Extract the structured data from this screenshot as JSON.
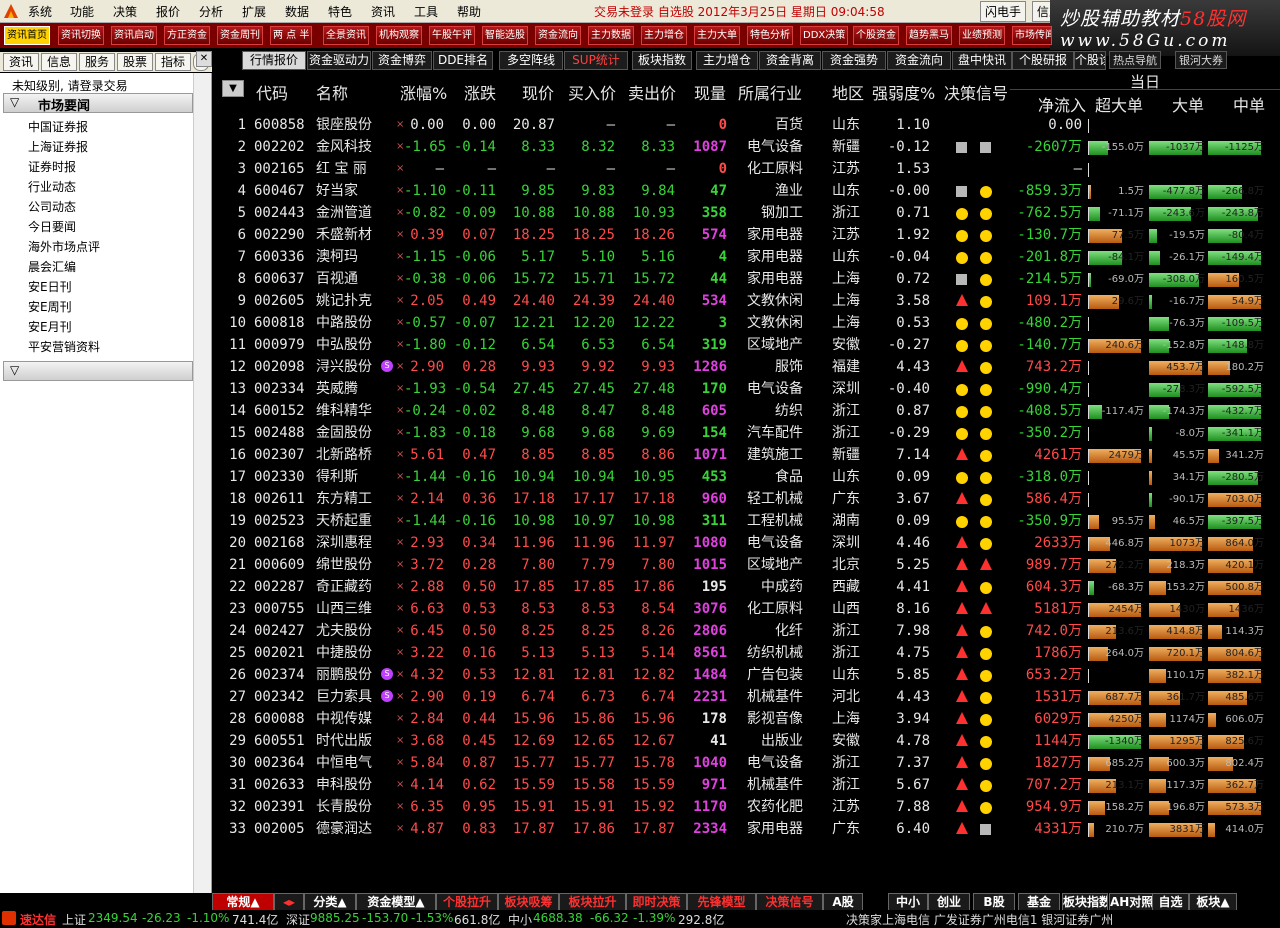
{
  "menu": {
    "items": [
      "系统",
      "功能",
      "决策",
      "报价",
      "分析",
      "扩展",
      "数据",
      "特色",
      "资讯",
      "工具",
      "帮助"
    ],
    "status": "交易未登录  自选股  2012年3月25日  星期日  09:04:58",
    "buttons": [
      "闪电手",
      "信息"
    ]
  },
  "watermark": {
    "line1a": "炒股辅助教材",
    "line1b": "58股网",
    "line2": "www.58Gu.com"
  },
  "toolbar": [
    "资讯首页",
    "资讯切换",
    "资讯启动",
    "方正资金",
    "资金周刊",
    "两 点 半",
    "全景资讯",
    "机构观察",
    "午股午评",
    "智能选股",
    "资金流向",
    "主力数据",
    "主力增仓",
    "主力大单",
    "特色分析",
    "DDX决策",
    "个股资金",
    "趋势黑马",
    "业绩预测",
    "市场传闻"
  ],
  "left": {
    "tabs": [
      "资讯",
      "信息",
      "服务",
      "股票",
      "指标"
    ],
    "login": "未知级别, 请登录交易",
    "section1": "市场要闻",
    "items": [
      "中国证券报",
      "上海证券报",
      "证券时报",
      "行业动态",
      "公司动态",
      "今日要闻",
      "海外市场点评",
      "晨会汇编",
      "安E日刊",
      "安E周刊",
      "安E月刊",
      "平安营销资料"
    ]
  },
  "toptabs": [
    "行情报价",
    "资金驱动力",
    "资金博弈",
    "DDE排名",
    "多空阵线",
    "SUP统计",
    "板块指数",
    "主力增仓",
    "资金背离",
    "资金强势",
    "资金流向",
    "盘中快讯",
    "个股研报",
    "个股诊断"
  ],
  "rtabs": [
    "热点导航",
    "银河大券"
  ],
  "header": {
    "cols": [
      "代码",
      "名称",
      "涨幅%",
      "涨跌",
      "现价",
      "买入价",
      "卖出价",
      "现量",
      "所属行业",
      "地区",
      "强弱度%",
      "决策信号",
      "净流入",
      "超大单",
      "大单",
      "中单"
    ],
    "group": "当日"
  },
  "rows": [
    {
      "n": 1,
      "code": "600858",
      "name": "银座股份",
      "pct": "0.00",
      "chg": "0.00",
      "price": "20.87",
      "bid": "—",
      "ask": "—",
      "vol": "0",
      "ind": "百货",
      "reg": "山东",
      "str": "1.10",
      "sig": [
        "",
        ""
      ],
      "net": "0.00",
      "b1": null,
      "b2": null,
      "b3": null
    },
    {
      "n": 2,
      "code": "002202",
      "name": "金风科技",
      "pct": "-1.65",
      "chg": "-0.14",
      "price": "8.33",
      "bid": "8.32",
      "ask": "8.33",
      "vol": "1087",
      "ind": "电气设备",
      "reg": "新疆",
      "str": "-0.12",
      "sig": [
        "sq",
        "sq"
      ],
      "net": "-2607万",
      "b1": {
        "v": "-155.0万",
        "w": -0.35
      },
      "b2": {
        "v": "-1037万",
        "w": -0.95
      },
      "b3": {
        "v": "-1125万",
        "w": -0.95
      }
    },
    {
      "n": 3,
      "code": "002165",
      "name": "红 宝 丽",
      "pct": "—",
      "chg": "—",
      "price": "—",
      "bid": "—",
      "ask": "—",
      "vol": "0",
      "ind": "化工原料",
      "reg": "江苏",
      "str": "1.53",
      "sig": [
        "",
        ""
      ],
      "net": "—",
      "b1": null,
      "b2": null,
      "b3": null
    },
    {
      "n": 4,
      "code": "600467",
      "name": "好当家",
      "pct": "-1.10",
      "chg": "-0.11",
      "price": "9.85",
      "bid": "9.83",
      "ask": "9.84",
      "vol": "47",
      "ind": "渔业",
      "reg": "山东",
      "str": "-0.00",
      "sig": [
        "sq",
        "ci"
      ],
      "net": "-859.3万",
      "b1": {
        "v": "1.5万",
        "w": 0.04
      },
      "b2": {
        "v": "-477.8万",
        "w": -0.95
      },
      "b3": {
        "v": "-266.8万",
        "w": -0.6
      }
    },
    {
      "n": 5,
      "code": "002443",
      "name": "金洲管道",
      "pct": "-0.82",
      "chg": "-0.09",
      "price": "10.88",
      "bid": "10.88",
      "ask": "10.93",
      "vol": "358",
      "ind": "钢加工",
      "reg": "浙江",
      "str": "0.71",
      "sig": [
        "ci",
        "ci"
      ],
      "net": "-762.5万",
      "b1": {
        "v": "-71.1万",
        "w": -0.22
      },
      "b2": {
        "v": "-243.6万",
        "w": -0.75
      },
      "b3": {
        "v": "-243.8万",
        "w": -0.9
      }
    },
    {
      "n": 6,
      "code": "002290",
      "name": "禾盛新材",
      "pct": "0.39",
      "chg": "0.07",
      "price": "18.25",
      "bid": "18.25",
      "ask": "18.26",
      "vol": "574",
      "ind": "家用电器",
      "reg": "江苏",
      "str": "1.92",
      "sig": [
        "ci",
        "ci"
      ],
      "net": "-130.7万",
      "b1": {
        "v": "77.5万",
        "w": 0.6
      },
      "b2": {
        "v": "-19.5万",
        "w": -0.15
      },
      "b3": {
        "v": "-80.4万",
        "w": -0.6
      }
    },
    {
      "n": 7,
      "code": "600336",
      "name": "澳柯玛",
      "pct": "-1.15",
      "chg": "-0.06",
      "price": "5.17",
      "bid": "5.10",
      "ask": "5.16",
      "vol": "4",
      "ind": "家用电器",
      "reg": "山东",
      "str": "-0.04",
      "sig": [
        "ci",
        "ci"
      ],
      "net": "-201.8万",
      "b1": {
        "v": "-84.1万",
        "w": -0.6
      },
      "b2": {
        "v": "-26.1万",
        "w": -0.2
      },
      "b3": {
        "v": "-149.4万",
        "w": -0.95
      }
    },
    {
      "n": 8,
      "code": "600637",
      "name": "百视通",
      "pct": "-0.38",
      "chg": "-0.06",
      "price": "15.72",
      "bid": "15.71",
      "ask": "15.72",
      "vol": "44",
      "ind": "家用电器",
      "reg": "上海",
      "str": "0.72",
      "sig": [
        "sq",
        "ci"
      ],
      "net": "-214.5万",
      "b1": {
        "v": "-69.0万",
        "w": -0.05
      },
      "b2": {
        "v": "-308.0万",
        "w": -0.9
      },
      "b3": {
        "v": "160.5万",
        "w": 0.55
      }
    },
    {
      "n": 9,
      "code": "002605",
      "name": "姚记扑克",
      "pct": "2.05",
      "chg": "0.49",
      "price": "24.40",
      "bid": "24.39",
      "ask": "24.40",
      "vol": "534",
      "ind": "文教休闲",
      "reg": "上海",
      "str": "3.58",
      "sig": [
        "tr",
        "ci"
      ],
      "net": "109.1万",
      "b1": {
        "v": "29.6万",
        "w": 0.55
      },
      "b2": {
        "v": "-16.7万",
        "w": -0.05
      },
      "b3": {
        "v": "54.9万",
        "w": 0.95
      }
    },
    {
      "n": 10,
      "code": "600818",
      "name": "中路股份",
      "pct": "-0.57",
      "chg": "-0.07",
      "price": "12.21",
      "bid": "12.20",
      "ask": "12.22",
      "vol": "3",
      "ind": "文教休闲",
      "reg": "上海",
      "str": "0.53",
      "sig": [
        "ci",
        "ci"
      ],
      "net": "-480.2万",
      "b1": null,
      "b2": {
        "v": "-76.3万",
        "w": -0.35
      },
      "b3": {
        "v": "-109.5万",
        "w": -0.95
      }
    },
    {
      "n": 11,
      "code": "000979",
      "name": "中弘股份",
      "pct": "-1.80",
      "chg": "-0.12",
      "price": "6.54",
      "bid": "6.53",
      "ask": "6.54",
      "vol": "319",
      "ind": "区域地产",
      "reg": "安徽",
      "str": "-0.27",
      "sig": [
        "ci",
        "ci"
      ],
      "net": "-140.7万",
      "b1": {
        "v": "240.6万",
        "w": 0.95
      },
      "b2": {
        "v": "-152.8万",
        "w": -0.35
      },
      "b3": {
        "v": "-148.8万",
        "w": -0.7
      }
    },
    {
      "n": 12,
      "code": "002098",
      "name": "浔兴股份",
      "badge": true,
      "pct": "2.90",
      "chg": "0.28",
      "price": "9.93",
      "bid": "9.92",
      "ask": "9.93",
      "vol": "1286",
      "ind": "服饰",
      "reg": "福建",
      "str": "4.43",
      "sig": [
        "tr",
        "ci"
      ],
      "net": "743.2万",
      "b1": null,
      "b2": {
        "v": "453.7万",
        "w": 0.95
      },
      "b3": {
        "v": "180.2万",
        "w": 0.4
      }
    },
    {
      "n": 13,
      "code": "002334",
      "name": "英威腾",
      "pct": "-1.93",
      "chg": "-0.54",
      "price": "27.45",
      "bid": "27.45",
      "ask": "27.48",
      "vol": "170",
      "ind": "电气设备",
      "reg": "深圳",
      "str": "-0.40",
      "sig": [
        "ci",
        "ci"
      ],
      "net": "-990.4万",
      "b1": null,
      "b2": {
        "v": "-278.3万",
        "w": -0.55
      },
      "b3": {
        "v": "-592.5万",
        "w": -0.95
      }
    },
    {
      "n": 14,
      "code": "600152",
      "name": "维科精华",
      "pct": "-0.24",
      "chg": "-0.02",
      "price": "8.48",
      "bid": "8.47",
      "ask": "8.48",
      "vol": "605",
      "ind": "纺织",
      "reg": "浙江",
      "str": "0.87",
      "sig": [
        "ci",
        "ci"
      ],
      "net": "-408.5万",
      "b1": {
        "v": "-117.4万",
        "w": -0.25
      },
      "b2": {
        "v": "-174.3万",
        "w": -0.35
      },
      "b3": {
        "v": "-432.7万",
        "w": -0.95
      }
    },
    {
      "n": 15,
      "code": "002488",
      "name": "金固股份",
      "pct": "-1.83",
      "chg": "-0.18",
      "price": "9.68",
      "bid": "9.68",
      "ask": "9.69",
      "vol": "154",
      "ind": "汽车配件",
      "reg": "浙江",
      "str": "-0.29",
      "sig": [
        "ci",
        "ci"
      ],
      "net": "-350.2万",
      "b1": null,
      "b2": {
        "v": "-8.0万",
        "w": -0.03
      },
      "b3": {
        "v": "-341.1万",
        "w": -0.95
      }
    },
    {
      "n": 16,
      "code": "002307",
      "name": "北新路桥",
      "pct": "5.61",
      "chg": "0.47",
      "price": "8.85",
      "bid": "8.85",
      "ask": "8.86",
      "vol": "1071",
      "ind": "建筑施工",
      "reg": "新疆",
      "str": "7.14",
      "sig": [
        "tr",
        "ci"
      ],
      "net": "4261万",
      "b1": {
        "v": "2479万",
        "w": 0.95
      },
      "b2": {
        "v": "45.5万",
        "w": 0.05
      },
      "b3": {
        "v": "341.2万",
        "w": 0.2
      }
    },
    {
      "n": 17,
      "code": "002330",
      "name": "得利斯",
      "pct": "-1.44",
      "chg": "-0.16",
      "price": "10.94",
      "bid": "10.94",
      "ask": "10.95",
      "vol": "453",
      "ind": "食品",
      "reg": "山东",
      "str": "0.09",
      "sig": [
        "ci",
        "ci"
      ],
      "net": "-318.0万",
      "b1": null,
      "b2": {
        "v": "34.1万",
        "w": 0.05
      },
      "b3": {
        "v": "-280.5万",
        "w": -0.9
      }
    },
    {
      "n": 18,
      "code": "002611",
      "name": "东方精工",
      "pct": "2.14",
      "chg": "0.36",
      "price": "17.18",
      "bid": "17.17",
      "ask": "17.18",
      "vol": "960",
      "ind": "轻工机械",
      "reg": "广东",
      "str": "3.67",
      "sig": [
        "tr",
        "ci"
      ],
      "net": "586.4万",
      "b1": null,
      "b2": {
        "v": "-90.1万",
        "w": -0.05
      },
      "b3": {
        "v": "703.0万",
        "w": 0.95
      }
    },
    {
      "n": 19,
      "code": "002523",
      "name": "天桥起重",
      "pct": "-1.44",
      "chg": "-0.16",
      "price": "10.98",
      "bid": "10.97",
      "ask": "10.98",
      "vol": "311",
      "ind": "工程机械",
      "reg": "湖南",
      "str": "0.09",
      "sig": [
        "ci",
        "ci"
      ],
      "net": "-350.9万",
      "b1": {
        "v": "95.5万",
        "w": 0.2
      },
      "b2": {
        "v": "46.5万",
        "w": 0.1
      },
      "b3": {
        "v": "-397.5万",
        "w": -0.95
      }
    },
    {
      "n": 20,
      "code": "002168",
      "name": "深圳惠程",
      "pct": "2.93",
      "chg": "0.34",
      "price": "11.96",
      "bid": "11.96",
      "ask": "11.97",
      "vol": "1080",
      "ind": "电气设备",
      "reg": "深圳",
      "str": "4.46",
      "sig": [
        "tr",
        "ci"
      ],
      "net": "2633万",
      "b1": {
        "v": "446.8万",
        "w": 0.4
      },
      "b2": {
        "v": "1073万",
        "w": 0.95
      },
      "b3": {
        "v": "864.0万",
        "w": 0.8
      }
    },
    {
      "n": 21,
      "code": "000609",
      "name": "绵世股份",
      "pct": "3.72",
      "chg": "0.28",
      "price": "7.80",
      "bid": "7.79",
      "ask": "7.80",
      "vol": "1015",
      "ind": "区域地产",
      "reg": "北京",
      "str": "5.25",
      "sig": [
        "tr",
        "tr"
      ],
      "net": "989.7万",
      "b1": {
        "v": "272.2万",
        "w": 0.5
      },
      "b2": {
        "v": "218.3万",
        "w": 0.4
      },
      "b3": {
        "v": "420.1万",
        "w": 0.8
      }
    },
    {
      "n": 22,
      "code": "002287",
      "name": "奇正藏药",
      "pct": "2.88",
      "chg": "0.50",
      "price": "17.85",
      "bid": "17.85",
      "ask": "17.86",
      "vol": "195",
      "ind": "中成药",
      "reg": "西藏",
      "str": "4.41",
      "sig": [
        "tr",
        "ci"
      ],
      "net": "604.3万",
      "b1": {
        "v": "-68.3万",
        "w": -0.1
      },
      "b2": {
        "v": "153.2万",
        "w": 0.3
      },
      "b3": {
        "v": "500.8万",
        "w": 0.95
      }
    },
    {
      "n": 23,
      "code": "000755",
      "name": "山西三维",
      "pct": "6.63",
      "chg": "0.53",
      "price": "8.53",
      "bid": "8.53",
      "ask": "8.54",
      "vol": "3076",
      "ind": "化工原料",
      "reg": "山西",
      "str": "8.16",
      "sig": [
        "tr",
        "tr"
      ],
      "net": "5181万",
      "b1": {
        "v": "2454万",
        "w": 0.95
      },
      "b2": {
        "v": "1430万",
        "w": 0.55
      },
      "b3": {
        "v": "1436万",
        "w": 0.55
      }
    },
    {
      "n": 24,
      "code": "002427",
      "name": "尤夫股份",
      "pct": "6.45",
      "chg": "0.50",
      "price": "8.25",
      "bid": "8.25",
      "ask": "8.26",
      "vol": "2806",
      "ind": "化纤",
      "reg": "浙江",
      "str": "7.98",
      "sig": [
        "tr",
        "ci"
      ],
      "net": "742.0万",
      "b1": {
        "v": "213.6万",
        "w": 0.5
      },
      "b2": {
        "v": "414.8万",
        "w": 0.95
      },
      "b3": {
        "v": "114.3万",
        "w": 0.25
      }
    },
    {
      "n": 25,
      "code": "002021",
      "name": "中捷股份",
      "pct": "3.22",
      "chg": "0.16",
      "price": "5.13",
      "bid": "5.13",
      "ask": "5.14",
      "vol": "8561",
      "ind": "纺织机械",
      "reg": "浙江",
      "str": "4.75",
      "sig": [
        "tr",
        "ci"
      ],
      "net": "1786万",
      "b1": {
        "v": "264.0万",
        "w": 0.35
      },
      "b2": {
        "v": "720.1万",
        "w": 0.95
      },
      "b3": {
        "v": "804.6万",
        "w": 0.95
      }
    },
    {
      "n": 26,
      "code": "002374",
      "name": "丽鹏股份",
      "badge": true,
      "pct": "4.32",
      "chg": "0.53",
      "price": "12.81",
      "bid": "12.81",
      "ask": "12.82",
      "vol": "1484",
      "ind": "广告包装",
      "reg": "山东",
      "str": "5.85",
      "sig": [
        "tr",
        "ci"
      ],
      "net": "653.2万",
      "b1": null,
      "b2": {
        "v": "110.1万",
        "w": 0.3
      },
      "b3": {
        "v": "382.1万",
        "w": 0.95
      }
    },
    {
      "n": 27,
      "code": "002342",
      "name": "巨力索具",
      "badge": true,
      "pct": "2.90",
      "chg": "0.19",
      "price": "6.74",
      "bid": "6.73",
      "ask": "6.74",
      "vol": "2231",
      "ind": "机械基件",
      "reg": "河北",
      "str": "4.43",
      "sig": [
        "tr",
        "ci"
      ],
      "net": "1531万",
      "b1": {
        "v": "687.7万",
        "w": 0.95
      },
      "b2": {
        "v": "361.7万",
        "w": 0.55
      },
      "b3": {
        "v": "485.6万",
        "w": 0.7
      }
    },
    {
      "n": 28,
      "code": "600088",
      "name": "中视传媒",
      "pct": "2.84",
      "chg": "0.44",
      "price": "15.96",
      "bid": "15.86",
      "ask": "15.96",
      "vol": "178",
      "ind": "影视音像",
      "reg": "上海",
      "str": "3.94",
      "sig": [
        "tr",
        "ci"
      ],
      "net": "6029万",
      "b1": {
        "v": "4250万",
        "w": 0.95
      },
      "b2": {
        "v": "1174万",
        "w": 0.3
      },
      "b3": {
        "v": "606.0万",
        "w": 0.15
      }
    },
    {
      "n": 29,
      "code": "600551",
      "name": "时代出版",
      "pct": "3.68",
      "chg": "0.45",
      "price": "12.69",
      "bid": "12.65",
      "ask": "12.67",
      "vol": "41",
      "ind": "出版业",
      "reg": "安徽",
      "str": "4.78",
      "sig": [
        "tr",
        "ci"
      ],
      "net": "1144万",
      "b1": {
        "v": "-1340万",
        "w": -0.95
      },
      "b2": {
        "v": "1295万",
        "w": 0.95
      },
      "b3": {
        "v": "825.6万",
        "w": 0.65
      }
    },
    {
      "n": 30,
      "code": "002364",
      "name": "中恒电气",
      "pct": "5.84",
      "chg": "0.87",
      "price": "15.77",
      "bid": "15.77",
      "ask": "15.78",
      "vol": "1040",
      "ind": "电气设备",
      "reg": "浙江",
      "str": "7.37",
      "sig": [
        "tr",
        "ci"
      ],
      "net": "1827万",
      "b1": {
        "v": "685.2万",
        "w": 0.4
      },
      "b2": {
        "v": "600.3万",
        "w": 0.35
      },
      "b3": {
        "v": "802.4万",
        "w": 0.45
      }
    },
    {
      "n": 31,
      "code": "002633",
      "name": "申科股份",
      "pct": "4.14",
      "chg": "0.62",
      "price": "15.59",
      "bid": "15.58",
      "ask": "15.59",
      "vol": "971",
      "ind": "机械基件",
      "reg": "浙江",
      "str": "5.67",
      "sig": [
        "tr",
        "ci"
      ],
      "net": "707.2万",
      "b1": {
        "v": "213.1万",
        "w": 0.5
      },
      "b2": {
        "v": "117.3万",
        "w": 0.3
      },
      "b3": {
        "v": "362.7万",
        "w": 0.85
      }
    },
    {
      "n": 32,
      "code": "002391",
      "name": "长青股份",
      "pct": "6.35",
      "chg": "0.95",
      "price": "15.91",
      "bid": "15.91",
      "ask": "15.92",
      "vol": "1170",
      "ind": "农药化肥",
      "reg": "江苏",
      "str": "7.88",
      "sig": [
        "tr",
        "ci"
      ],
      "net": "954.9万",
      "b1": {
        "v": "158.2万",
        "w": 0.3
      },
      "b2": {
        "v": "196.8万",
        "w": 0.35
      },
      "b3": {
        "v": "573.3万",
        "w": 0.95
      }
    },
    {
      "n": 33,
      "code": "002005",
      "name": "德豪润达",
      "pct": "4.87",
      "chg": "0.83",
      "price": "17.87",
      "bid": "17.86",
      "ask": "17.87",
      "vol": "2334",
      "ind": "家用电器",
      "reg": "广东",
      "str": "6.40",
      "sig": [
        "tr",
        "sq"
      ],
      "net": "4331万",
      "b1": {
        "v": "210.7万",
        "w": 0.1
      },
      "b2": {
        "v": "3831万",
        "w": 0.95
      },
      "b3": {
        "v": "414.0万",
        "w": 0.12
      }
    }
  ],
  "bottomtabs": [
    "常规▲",
    "分类▲",
    "资金模型▲",
    "个股拉升",
    "板块吸筹",
    "板块拉升",
    "即时决策",
    "先锋模型",
    "决策信号",
    "A股",
    "中小",
    "创业",
    "B股",
    "基金",
    "板块指数",
    "AH对照",
    "自选",
    "板块▲"
  ],
  "statusbar": {
    "brand": "速达信",
    "sh_label": "上证",
    "sh_val": "2349.54",
    "sh_chg": "-26.23",
    "sh_pct": "-1.10%",
    "sh_amt": "741.4亿",
    "sz_label": "深证",
    "sz_val": "9885.25",
    "sz_chg": "-153.70",
    "sz_pct": "-1.53%",
    "sz_amt": "661.8亿",
    "zx_label": "中小",
    "zx_val": "4688.38",
    "zx_chg": "-66.32",
    "zx_pct": "-1.39%",
    "zx_amt": "292.8亿",
    "servers": "决策家上海电信  广发证券广州电信1  银河证券广州"
  },
  "colors": {
    "up": "#ff4b4b",
    "down": "#38d438",
    "accent": "#bf0000"
  }
}
